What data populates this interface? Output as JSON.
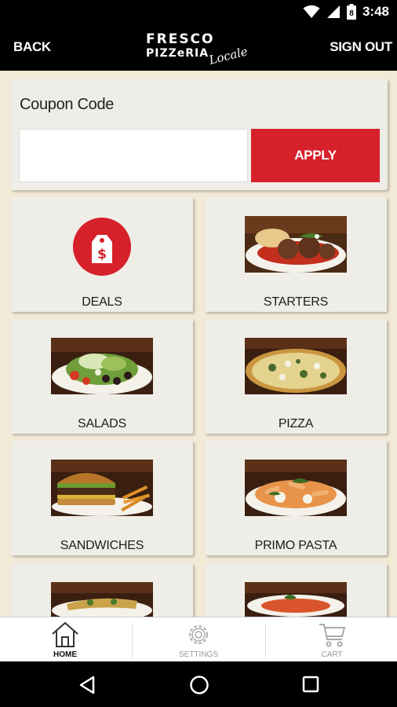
{
  "status_bar": {
    "time": "3:48",
    "battery_level": "8"
  },
  "header": {
    "back_label": "BACK",
    "signout_label": "SIGN OUT",
    "logo": {
      "line1": "FRESCO",
      "line2": "PIZZeRIA",
      "script": "Locale"
    }
  },
  "coupon": {
    "label": "Coupon Code",
    "input_value": "",
    "apply_label": "APPLY"
  },
  "menu": {
    "tiles": [
      {
        "label": "DEALS",
        "icon": "price-tag-icon"
      },
      {
        "label": "STARTERS",
        "image": "meatballs-photo"
      },
      {
        "label": "SALADS",
        "image": "salad-photo"
      },
      {
        "label": "PIZZA",
        "image": "pizza-photo"
      },
      {
        "label": "SANDWICHES",
        "image": "burger-photo"
      },
      {
        "label": "PRIMO PASTA",
        "image": "pasta-photo"
      },
      {
        "label": "",
        "image": "flatbread-photo"
      },
      {
        "label": "",
        "image": "soup-photo"
      }
    ]
  },
  "bottom_nav": {
    "tabs": [
      {
        "label": "HOME",
        "icon": "home-icon",
        "active": true
      },
      {
        "label": "SETTINGS",
        "icon": "gear-icon",
        "active": false
      },
      {
        "label": "CART",
        "icon": "cart-icon",
        "active": false
      }
    ]
  },
  "colors": {
    "accent_red": "#d6202a",
    "background_cream": "#f2e9d6",
    "card": "#efede7",
    "header_black": "#000000"
  }
}
